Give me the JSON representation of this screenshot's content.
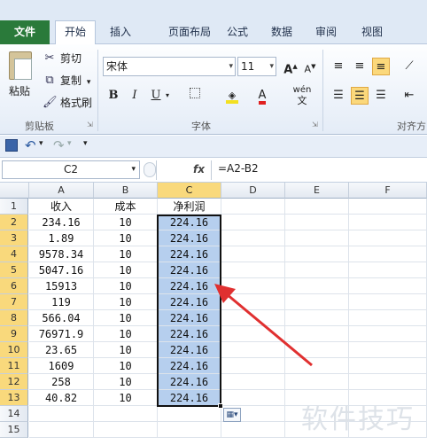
{
  "ribbon": {
    "tabs": [
      "文件",
      "开始",
      "插入",
      "页面布局",
      "公式",
      "数据",
      "审阅",
      "视图"
    ],
    "active_tab": "开始",
    "clipboard": {
      "paste_label": "粘贴",
      "cut_label": "剪切",
      "copy_label": "复制",
      "format_painter_label": "格式刷",
      "group_label": "剪贴板"
    },
    "font": {
      "font_name": "宋体",
      "font_size": "11",
      "bold": "B",
      "italic": "I",
      "underline": "U",
      "phonetic": "wén",
      "group_label": "字体"
    },
    "alignment": {
      "group_label": "对齐方"
    }
  },
  "formula_bar": {
    "name_box": "C2",
    "fx_label": "fx",
    "formula": "=A2-B2"
  },
  "sheet": {
    "columns": [
      "A",
      "B",
      "C",
      "D",
      "E",
      "F"
    ],
    "selected_column": "C",
    "rows": [
      {
        "num": "1",
        "a": "收入",
        "b": "成本",
        "c": "净利润"
      },
      {
        "num": "2",
        "a": "234.16",
        "b": "10",
        "c": "224.16"
      },
      {
        "num": "3",
        "a": "1.89",
        "b": "10",
        "c": "224.16"
      },
      {
        "num": "4",
        "a": "9578.34",
        "b": "10",
        "c": "224.16"
      },
      {
        "num": "5",
        "a": "5047.16",
        "b": "10",
        "c": "224.16"
      },
      {
        "num": "6",
        "a": "15913",
        "b": "10",
        "c": "224.16"
      },
      {
        "num": "7",
        "a": "119",
        "b": "10",
        "c": "224.16"
      },
      {
        "num": "8",
        "a": "566.04",
        "b": "10",
        "c": "224.16"
      },
      {
        "num": "9",
        "a": "76971.9",
        "b": "10",
        "c": "224.16"
      },
      {
        "num": "10",
        "a": "23.65",
        "b": "10",
        "c": "224.16"
      },
      {
        "num": "11",
        "a": "1609",
        "b": "10",
        "c": "224.16"
      },
      {
        "num": "12",
        "a": "258",
        "b": "10",
        "c": "224.16"
      },
      {
        "num": "13",
        "a": "40.82",
        "b": "10",
        "c": "224.16"
      },
      {
        "num": "14",
        "a": "",
        "b": "",
        "c": ""
      },
      {
        "num": "15",
        "a": "",
        "b": "",
        "c": ""
      }
    ]
  },
  "watermark_text": "软件技巧",
  "colors": {
    "file_tab": "#2a7a3a",
    "selection_fill": "#b6cfee",
    "header_highlight": "#f9d97c",
    "arrow": "#e03030"
  }
}
